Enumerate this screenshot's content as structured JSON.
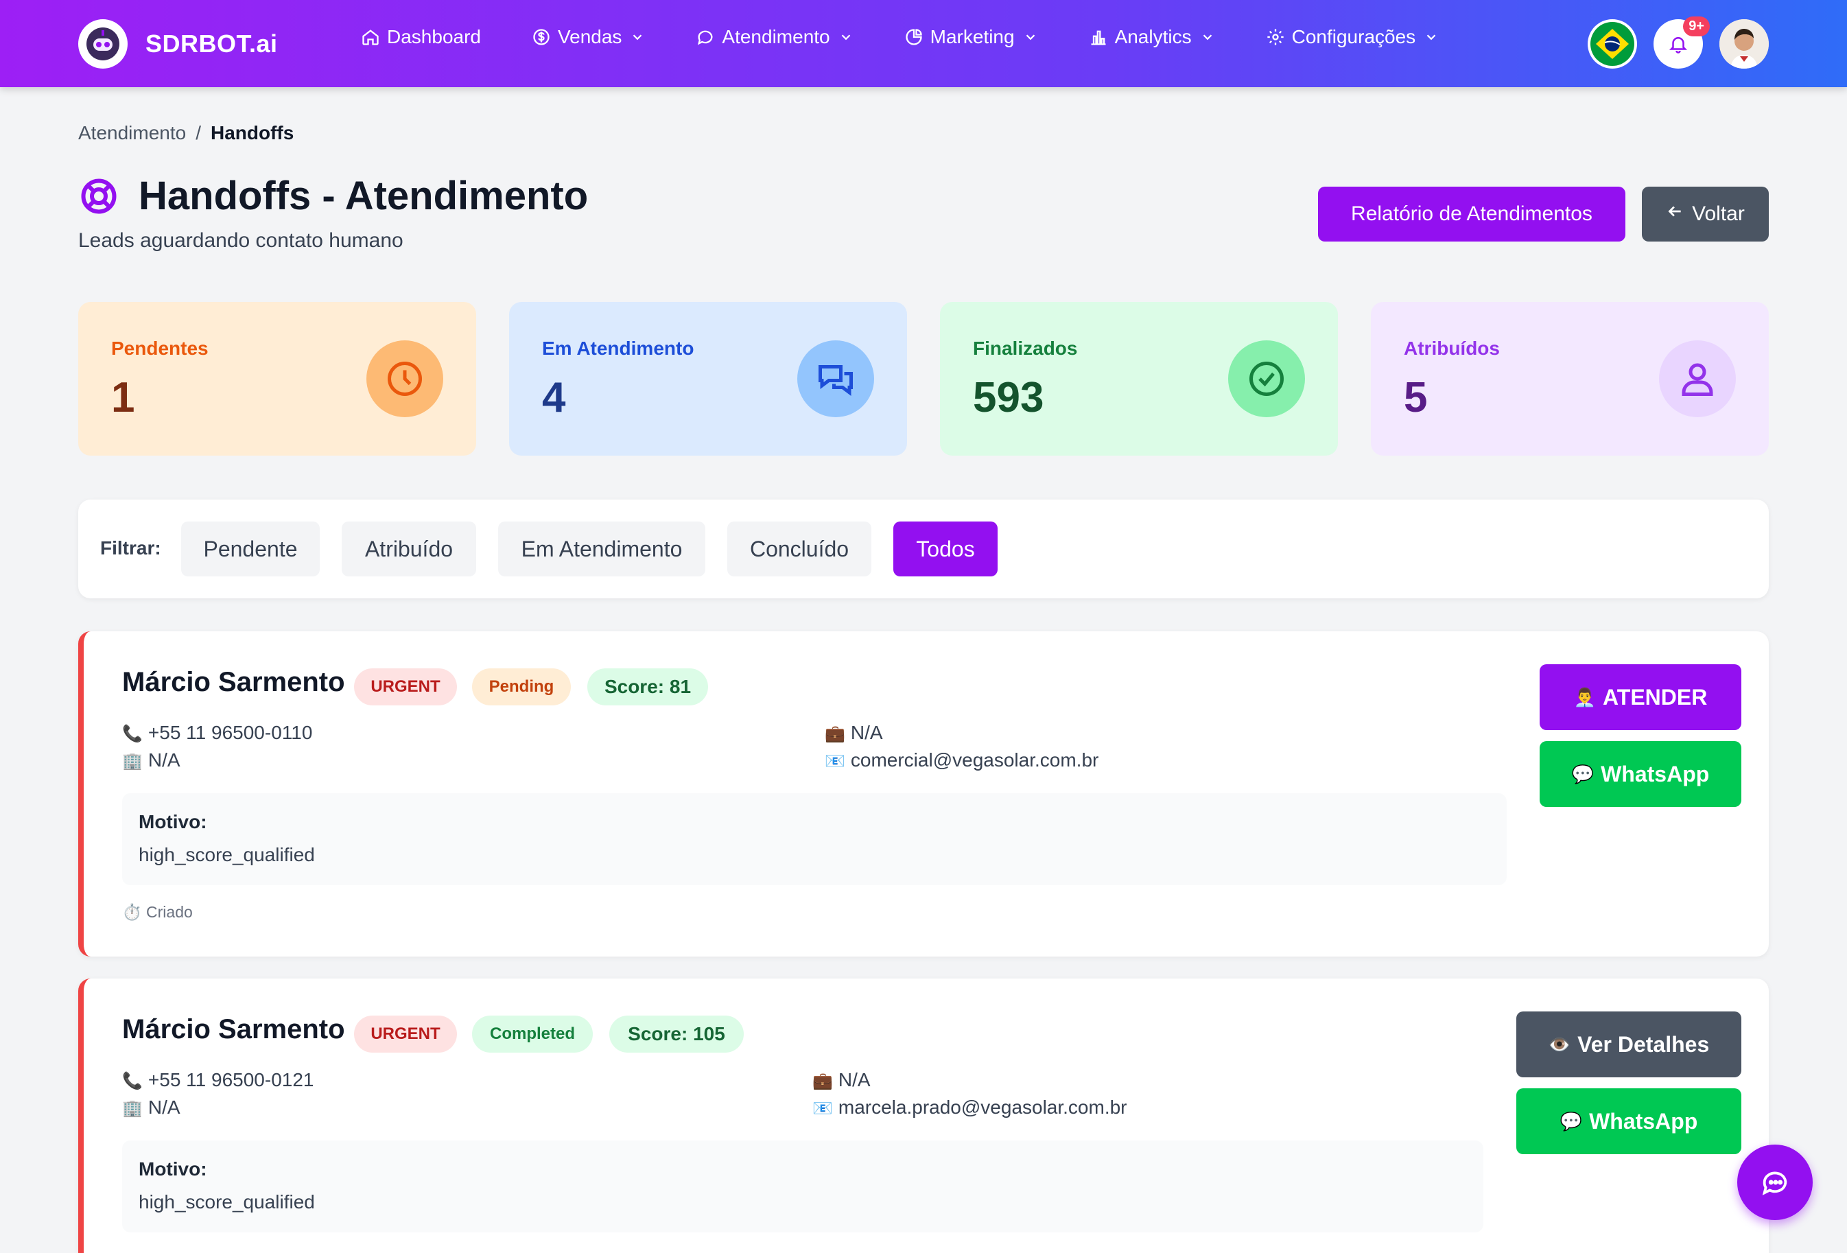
{
  "brand": {
    "name": "SDRBOT.ai"
  },
  "nav": {
    "items": [
      {
        "label": "Dashboard",
        "icon": "home-icon",
        "dropdown": false
      },
      {
        "label": "Vendas",
        "icon": "dollar-icon",
        "dropdown": true
      },
      {
        "label": "Atendimento",
        "icon": "chat-icon",
        "dropdown": true
      },
      {
        "label": "Marketing",
        "icon": "pie-chart-icon",
        "dropdown": true
      },
      {
        "label": "Analytics",
        "icon": "bar-chart-icon",
        "dropdown": true
      },
      {
        "label": "Configurações",
        "icon": "gear-icon",
        "dropdown": true
      }
    ]
  },
  "header_right": {
    "notifications_count": "9+",
    "language_flag": "brazil-flag-icon"
  },
  "breadcrumb": {
    "parent": "Atendimento",
    "separator": "/",
    "current": "Handoffs"
  },
  "page": {
    "title": "Handoffs - Atendimento",
    "subtitle": "Leads aguardando contato humano",
    "report_button": "Relatório de Atendimentos",
    "back_button": "Voltar"
  },
  "stats": [
    {
      "label": "Pendentes",
      "value": "1",
      "icon": "clock-icon"
    },
    {
      "label": "Em Atendimento",
      "value": "4",
      "icon": "chat-bubbles-icon"
    },
    {
      "label": "Finalizados",
      "value": "593",
      "icon": "check-circle-icon"
    },
    {
      "label": "Atribuídos",
      "value": "5",
      "icon": "user-icon"
    }
  ],
  "filters": {
    "label": "Filtrar:",
    "options": [
      "Pendente",
      "Atribuído",
      "Em Atendimento",
      "Concluído",
      "Todos"
    ],
    "active": "Todos"
  },
  "leads": [
    {
      "name": "Márcio Sarmento",
      "priority": "URGENT",
      "status": "Pending",
      "score": "Score: 81",
      "phone": "+55 11 96500-0110",
      "company": "N/A",
      "role": "N/A",
      "email": "comercial@vegasolar.com.br",
      "motivo_label": "Motivo:",
      "motivo": "high_score_qualified",
      "created": "Criado",
      "primary_action": "ATENDER",
      "secondary_action": "WhatsApp"
    },
    {
      "name": "Márcio Sarmento",
      "priority": "URGENT",
      "status": "Completed",
      "score": "Score: 105",
      "phone": "+55 11 96500-0121",
      "company": "N/A",
      "role": "N/A",
      "email": "marcela.prado@vegasolar.com.br",
      "motivo_label": "Motivo:",
      "motivo": "high_score_qualified",
      "primary_action": "Ver Detalhes",
      "secondary_action": "WhatsApp"
    }
  ],
  "colors": {
    "accent_purple": "#9310f0",
    "whatsapp_green": "#00c853",
    "urgent_red": "#ef4444",
    "gray_button": "#4b5563"
  }
}
